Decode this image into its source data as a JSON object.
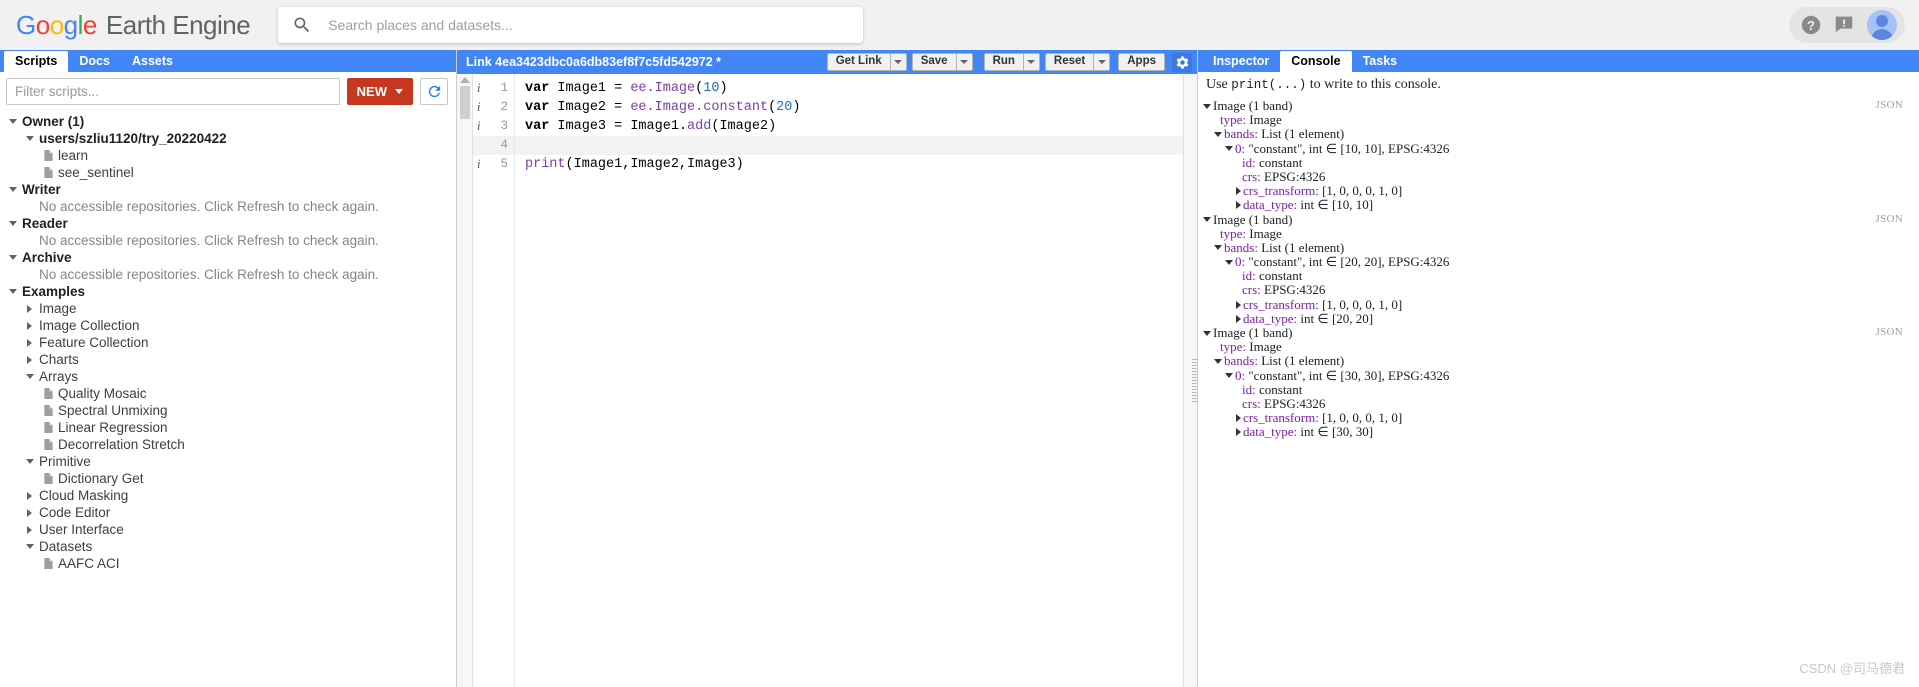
{
  "header": {
    "logo": {
      "word1": "Google",
      "word2": "Earth Engine"
    },
    "search": {
      "placeholder": "Search places and datasets...",
      "value": "",
      "icon": "search-icon"
    },
    "help_icon": "help-circle-icon",
    "feedback_icon": "feedback-icon",
    "avatar": "user-avatar"
  },
  "left_panel": {
    "tabs": [
      {
        "label": "Scripts",
        "active": true
      },
      {
        "label": "Docs",
        "active": false
      },
      {
        "label": "Assets",
        "active": false
      }
    ],
    "filter": {
      "placeholder": "Filter scripts...",
      "value": ""
    },
    "new_button": "NEW",
    "refresh_icon": "refresh-icon",
    "tree": [
      {
        "label": "Owner (1)",
        "depth": 0,
        "twisty": "down",
        "style": "bold"
      },
      {
        "label": "users/szliu1120/try_20220422",
        "depth": 1,
        "twisty": "down",
        "style": "bold"
      },
      {
        "label": "learn",
        "depth": 2,
        "twisty": "doc",
        "style": "norm"
      },
      {
        "label": "see_sentinel",
        "depth": 2,
        "twisty": "doc",
        "style": "norm"
      },
      {
        "label": "Writer",
        "depth": 0,
        "twisty": "down",
        "style": "bold"
      },
      {
        "label": "No accessible repositories. Click Refresh to check again.",
        "depth": 1,
        "twisty": "none",
        "style": "muted"
      },
      {
        "label": "Reader",
        "depth": 0,
        "twisty": "down",
        "style": "bold"
      },
      {
        "label": "No accessible repositories. Click Refresh to check again.",
        "depth": 1,
        "twisty": "none",
        "style": "muted"
      },
      {
        "label": "Archive",
        "depth": 0,
        "twisty": "down",
        "style": "bold"
      },
      {
        "label": "No accessible repositories. Click Refresh to check again.",
        "depth": 1,
        "twisty": "none",
        "style": "muted"
      },
      {
        "label": "Examples",
        "depth": 0,
        "twisty": "down",
        "style": "bold"
      },
      {
        "label": "Image",
        "depth": 1,
        "twisty": "right",
        "style": "norm"
      },
      {
        "label": "Image Collection",
        "depth": 1,
        "twisty": "right",
        "style": "norm"
      },
      {
        "label": "Feature Collection",
        "depth": 1,
        "twisty": "right",
        "style": "norm"
      },
      {
        "label": "Charts",
        "depth": 1,
        "twisty": "right",
        "style": "norm"
      },
      {
        "label": "Arrays",
        "depth": 1,
        "twisty": "down",
        "style": "norm"
      },
      {
        "label": "Quality Mosaic",
        "depth": 2,
        "twisty": "doc",
        "style": "norm"
      },
      {
        "label": "Spectral Unmixing",
        "depth": 2,
        "twisty": "doc",
        "style": "norm"
      },
      {
        "label": "Linear Regression",
        "depth": 2,
        "twisty": "doc",
        "style": "norm"
      },
      {
        "label": "Decorrelation Stretch",
        "depth": 2,
        "twisty": "doc",
        "style": "norm"
      },
      {
        "label": "Primitive",
        "depth": 1,
        "twisty": "down",
        "style": "norm"
      },
      {
        "label": "Dictionary Get",
        "depth": 2,
        "twisty": "doc",
        "style": "norm"
      },
      {
        "label": "Cloud Masking",
        "depth": 1,
        "twisty": "right",
        "style": "norm"
      },
      {
        "label": "Code Editor",
        "depth": 1,
        "twisty": "right",
        "style": "norm"
      },
      {
        "label": "User Interface",
        "depth": 1,
        "twisty": "right",
        "style": "norm"
      },
      {
        "label": "Datasets",
        "depth": 1,
        "twisty": "down",
        "style": "norm"
      },
      {
        "label": "AAFC ACI",
        "depth": 2,
        "twisty": "doc",
        "style": "norm"
      }
    ]
  },
  "editor": {
    "title": "Link 4ea3423dbc0a6db83ef8f7c5fd542972 *",
    "buttons": {
      "get_link": "Get Link",
      "save": "Save",
      "run": "Run",
      "reset": "Reset",
      "apps": "Apps",
      "settings_icon": "gear-icon"
    },
    "lines": [
      {
        "n": "1",
        "info": true,
        "blank": false
      },
      {
        "n": "2",
        "info": true,
        "blank": false
      },
      {
        "n": "3",
        "info": true,
        "blank": false
      },
      {
        "n": "4",
        "info": false,
        "blank": true
      },
      {
        "n": "5",
        "info": true,
        "blank": false
      }
    ],
    "code": [
      "var Image1 = ee.Image(10)",
      "var Image2 = ee.Image.constant(20)",
      "var Image3 = Image1.add(Image2)",
      "",
      "print(Image1,Image2,Image3)"
    ]
  },
  "console": {
    "tabs": [
      {
        "label": "Inspector",
        "active": false
      },
      {
        "label": "Console",
        "active": true
      },
      {
        "label": "Tasks",
        "active": false
      }
    ],
    "hint_prefix": "Use ",
    "hint_code": "print(...)",
    "hint_suffix": " to write to this console.",
    "json_label": "JSON",
    "objects": [
      {
        "header": "Image (1 band)",
        "rows": [
          {
            "indent": 1,
            "twisty": "none",
            "key": "type:",
            "value": " Image",
            "key_color": "purple"
          },
          {
            "indent": 1,
            "twisty": "down",
            "key": "bands:",
            "value": " List (1 element)",
            "key_color": "purple"
          },
          {
            "indent": 2,
            "twisty": "down",
            "key": "0:",
            "value": " \"constant\", int ∈ [10, 10], EPSG:4326",
            "key_color": "purple"
          },
          {
            "indent": 3,
            "twisty": "none",
            "key": "id:",
            "value": " constant",
            "key_color": "purple"
          },
          {
            "indent": 3,
            "twisty": "none",
            "key": "crs:",
            "value": " EPSG:4326",
            "key_color": "purple"
          },
          {
            "indent": 3,
            "twisty": "right",
            "key": "crs_transform:",
            "value": " [1, 0, 0, 0, 1, 0]",
            "key_color": "purple"
          },
          {
            "indent": 3,
            "twisty": "right",
            "key": "data_type:",
            "value": " int ∈ [10, 10]",
            "key_color": "purple"
          }
        ]
      },
      {
        "header": "Image (1 band)",
        "rows": [
          {
            "indent": 1,
            "twisty": "none",
            "key": "type:",
            "value": " Image",
            "key_color": "purple"
          },
          {
            "indent": 1,
            "twisty": "down",
            "key": "bands:",
            "value": " List (1 element)",
            "key_color": "purple"
          },
          {
            "indent": 2,
            "twisty": "down",
            "key": "0:",
            "value": " \"constant\", int ∈ [20, 20], EPSG:4326",
            "key_color": "purple"
          },
          {
            "indent": 3,
            "twisty": "none",
            "key": "id:",
            "value": " constant",
            "key_color": "purple"
          },
          {
            "indent": 3,
            "twisty": "none",
            "key": "crs:",
            "value": " EPSG:4326",
            "key_color": "purple"
          },
          {
            "indent": 3,
            "twisty": "right",
            "key": "crs_transform:",
            "value": " [1, 0, 0, 0, 1, 0]",
            "key_color": "purple"
          },
          {
            "indent": 3,
            "twisty": "right",
            "key": "data_type:",
            "value": " int ∈ [20, 20]",
            "key_color": "purple"
          }
        ]
      },
      {
        "header": "Image (1 band)",
        "rows": [
          {
            "indent": 1,
            "twisty": "none",
            "key": "type:",
            "value": " Image",
            "key_color": "purple"
          },
          {
            "indent": 1,
            "twisty": "down",
            "key": "bands:",
            "value": " List (1 element)",
            "key_color": "purple"
          },
          {
            "indent": 2,
            "twisty": "down",
            "key": "0:",
            "value": " \"constant\", int ∈ [30, 30], EPSG:4326",
            "key_color": "purple"
          },
          {
            "indent": 3,
            "twisty": "none",
            "key": "id:",
            "value": " constant",
            "key_color": "purple"
          },
          {
            "indent": 3,
            "twisty": "none",
            "key": "crs:",
            "value": " EPSG:4326",
            "key_color": "purple"
          },
          {
            "indent": 3,
            "twisty": "right",
            "key": "crs_transform:",
            "value": " [1, 0, 0, 0, 1, 0]",
            "key_color": "purple"
          },
          {
            "indent": 3,
            "twisty": "right",
            "key": "data_type:",
            "value": " int ∈ [30, 30]",
            "key_color": "purple"
          }
        ]
      }
    ]
  },
  "watermark": "CSDN @司马德君",
  "colors": {
    "brand_blue": "#4285F4",
    "new_red": "#c5381f",
    "key_purple": "#7b1fa2",
    "header_bg": "#f1f1f1"
  }
}
